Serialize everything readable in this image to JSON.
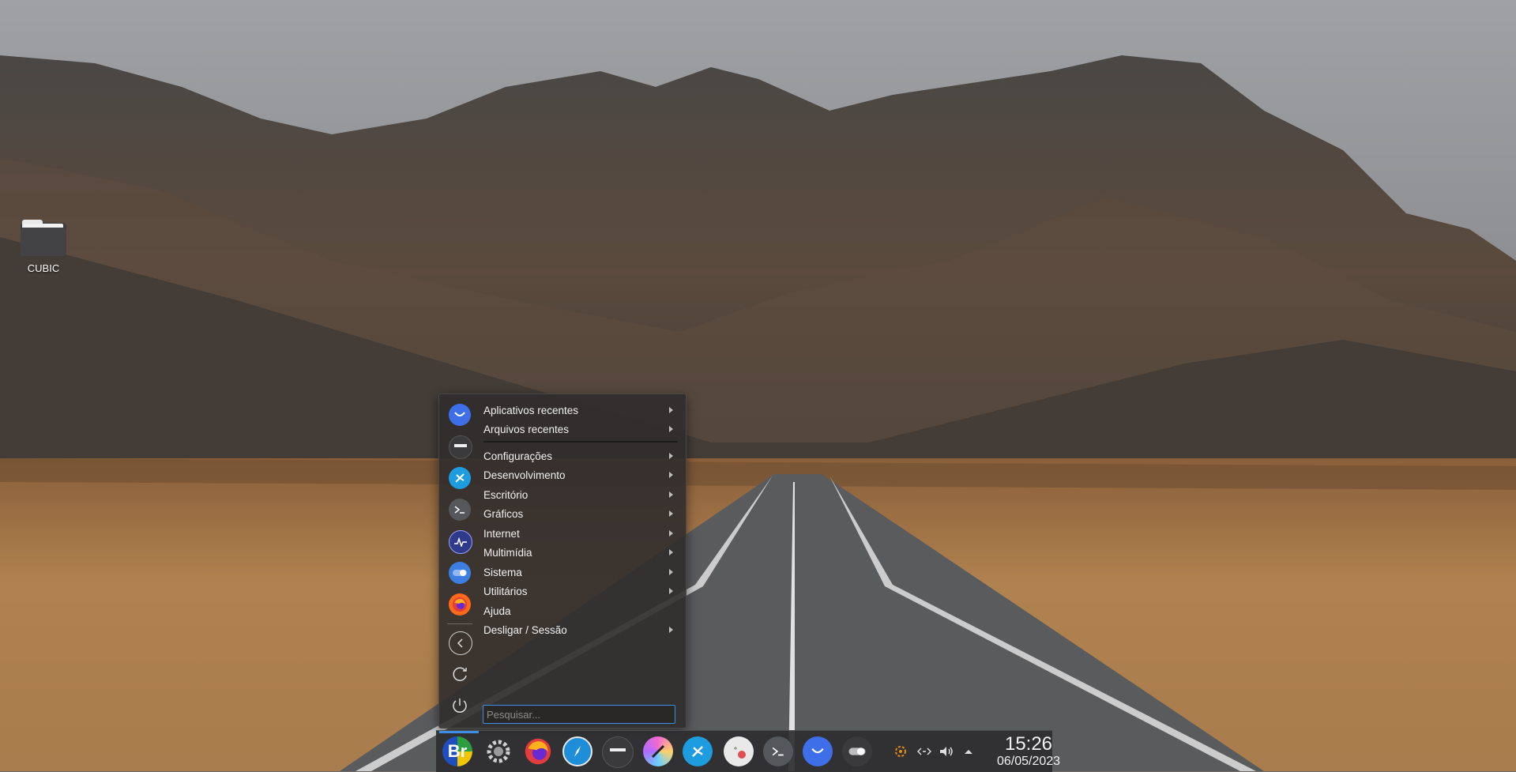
{
  "desktop": {
    "icons": [
      {
        "label": "CUBIC",
        "icon": "folder-icon"
      }
    ]
  },
  "menu": {
    "items": [
      {
        "label": "Aplicativos recentes",
        "submenu": true
      },
      {
        "label": "Arquivos recentes",
        "submenu": true
      },
      {
        "label": "Configurações",
        "submenu": true
      },
      {
        "label": "Desenvolvimento",
        "submenu": true
      },
      {
        "label": "Escritório",
        "submenu": true
      },
      {
        "label": "Gráficos",
        "submenu": true
      },
      {
        "label": "Internet",
        "submenu": true
      },
      {
        "label": "Multimídia",
        "submenu": true
      },
      {
        "label": "Sistema",
        "submenu": true
      },
      {
        "label": "Utilitários",
        "submenu": true
      },
      {
        "label": "Ajuda",
        "submenu": false
      },
      {
        "label": "Desligar / Sessão",
        "submenu": true
      }
    ],
    "side_icons": [
      "blue-circle-app-icon",
      "file-manager-icon",
      "settings-app-icon",
      "terminal-icon",
      "monitor-app-icon",
      "toggle-app-icon",
      "firefox-icon",
      "back-icon",
      "refresh-icon",
      "power-icon"
    ],
    "search_placeholder": "Pesquisar..."
  },
  "taskbar": {
    "apps": [
      "start-menu-logo",
      "gear-app-icon",
      "firefox-icon",
      "browser-compass-icon",
      "file-manager-icon",
      "paint-app-icon",
      "settings-app-icon",
      "clock-app-icon",
      "terminal-icon",
      "blue-circle-app-icon",
      "toggle-app-icon"
    ],
    "tray": [
      "update-icon",
      "network-icon",
      "volume-icon",
      "expand-tray-icon"
    ],
    "clock": {
      "time": "15:26",
      "date": "06/05/2023"
    }
  },
  "colors": {
    "accent": "#3d8ee6",
    "panel": "#2e2e30",
    "menu_bg": "#302c2c"
  }
}
